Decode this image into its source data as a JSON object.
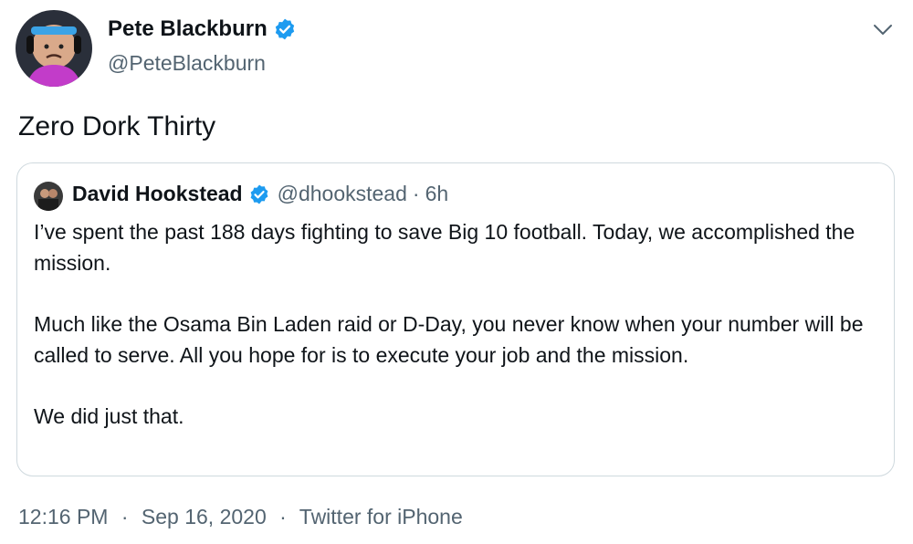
{
  "author": {
    "name": "Pete Blackburn",
    "handle": "@PeteBlackburn",
    "avatar_icon": "profile-avatar",
    "verified_icon": "verified-badge-icon"
  },
  "more_icon": "chevron-down-icon",
  "tweet": {
    "text": "Zero Dork Thirty"
  },
  "quoted_tweet": {
    "name": "David Hookstead",
    "handle": "@dhookstead",
    "separator": "·",
    "time": "6h",
    "paragraphs": [
      "I’ve spent the past 188 days fighting to save Big 10 football. Today, we accomplished the mission.",
      "Much like the Osama Bin Laden raid or D-Day, you never know when your number will be called to serve. All you hope for is to execute your job and the mission.",
      "We did just that."
    ]
  },
  "meta": {
    "time": "12:16 PM",
    "separator": "·",
    "date": "Sep 16, 2020",
    "source": "Twitter for iPhone"
  },
  "colors": {
    "verified_blue": "#1d9bf0",
    "secondary_text": "#536471",
    "border": "#cfd9de"
  }
}
